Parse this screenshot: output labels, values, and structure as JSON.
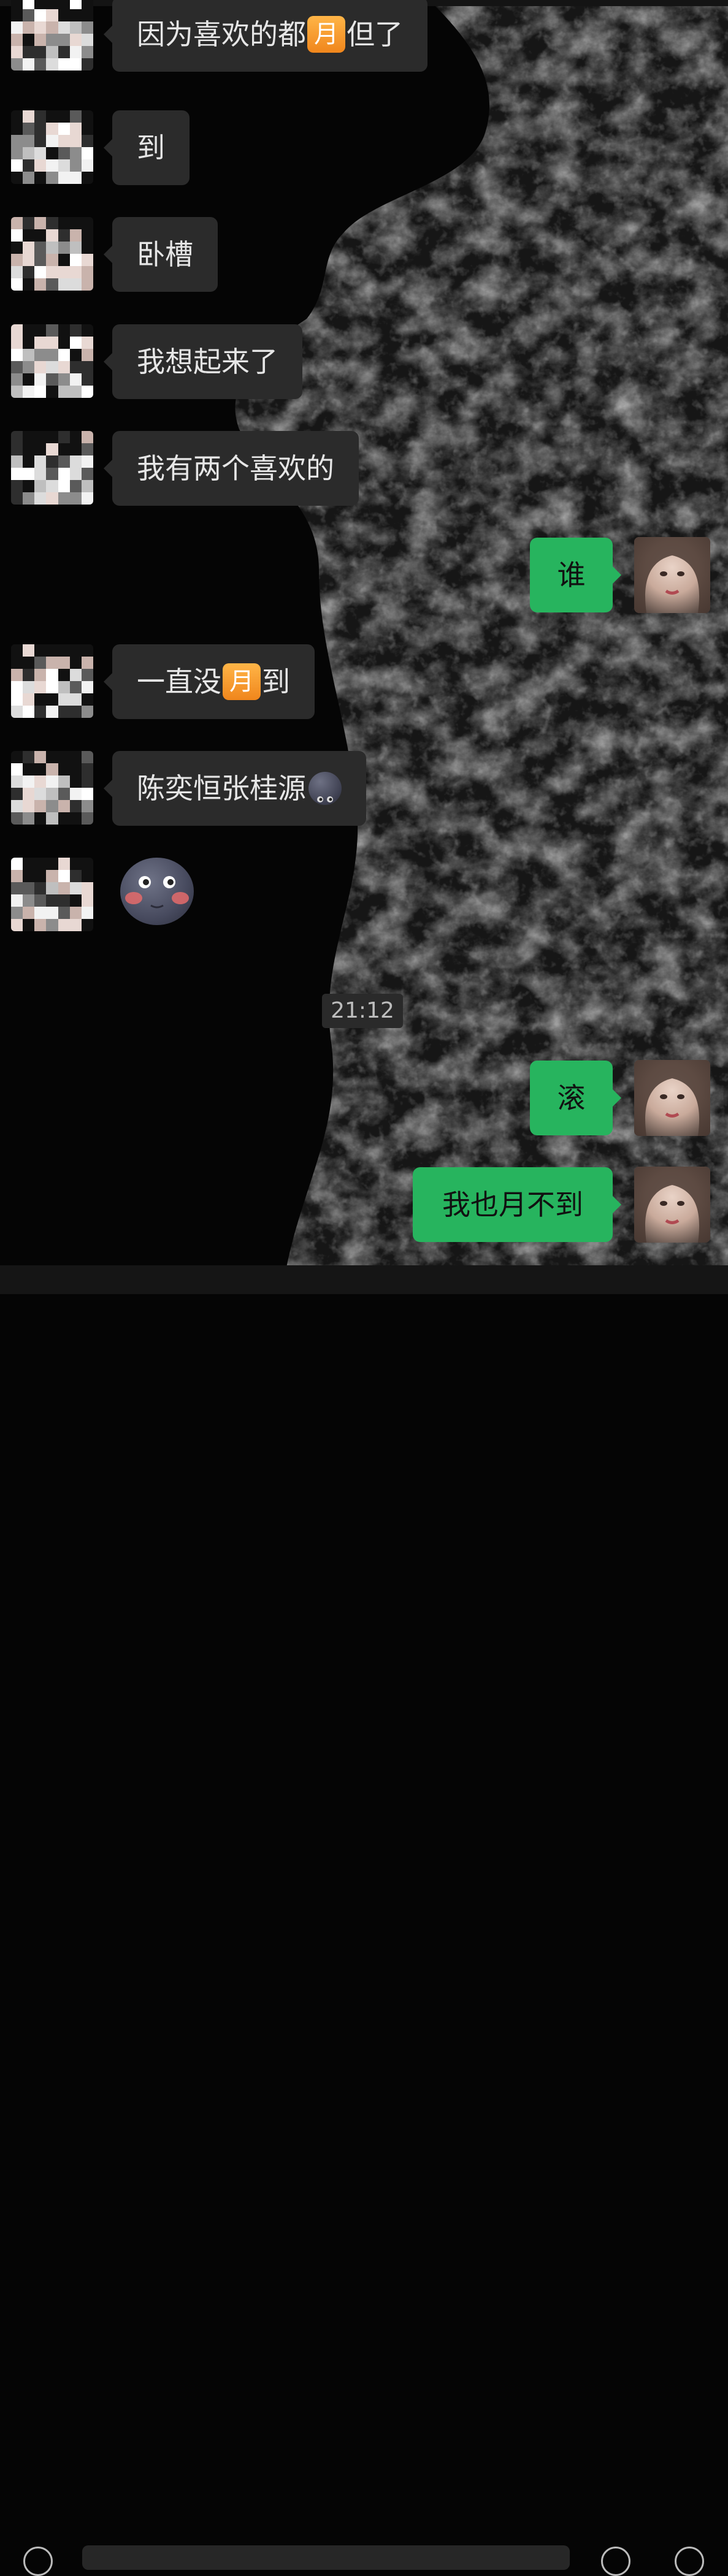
{
  "colors": {
    "background": "#050505",
    "incoming_bubble": "#2b2b2b",
    "outgoing_bubble": "#27b45e",
    "badge": "#f59a2e",
    "timestamp_bg": "#2a2a2a"
  },
  "messages": [
    {
      "side": "in",
      "parts": [
        {
          "t": "因为喜欢的都"
        },
        {
          "badge": "月"
        },
        {
          "t": "但了"
        }
      ]
    },
    {
      "side": "in",
      "parts": [
        {
          "t": "到"
        }
      ]
    },
    {
      "side": "in",
      "parts": [
        {
          "t": "卧槽"
        }
      ]
    },
    {
      "side": "in",
      "parts": [
        {
          "t": "我想起来了"
        }
      ]
    },
    {
      "side": "in",
      "parts": [
        {
          "t": "我有两个喜欢的"
        }
      ]
    },
    {
      "side": "out",
      "parts": [
        {
          "t": "谁"
        }
      ]
    },
    {
      "side": "in",
      "parts": [
        {
          "t": "一直没"
        },
        {
          "badge": "月"
        },
        {
          "t": "到"
        }
      ]
    },
    {
      "side": "in",
      "parts": [
        {
          "t": "陈奕恒张桂源"
        },
        {
          "emoji": "new-moon-face-icon"
        }
      ]
    },
    {
      "side": "in",
      "sticker": "blushing-moon-sticker"
    },
    {
      "side": "out",
      "parts": [
        {
          "t": "滚"
        }
      ]
    },
    {
      "side": "out",
      "parts": [
        {
          "t": "我也月不到"
        }
      ]
    }
  ],
  "timestamp": "21:12",
  "icons": {
    "incoming_avatar": "pixelated-avatar",
    "outgoing_avatar": "girl-avatar",
    "moon_emoji": "new-moon-face-icon",
    "sticker": "blushing-moon-sticker"
  }
}
